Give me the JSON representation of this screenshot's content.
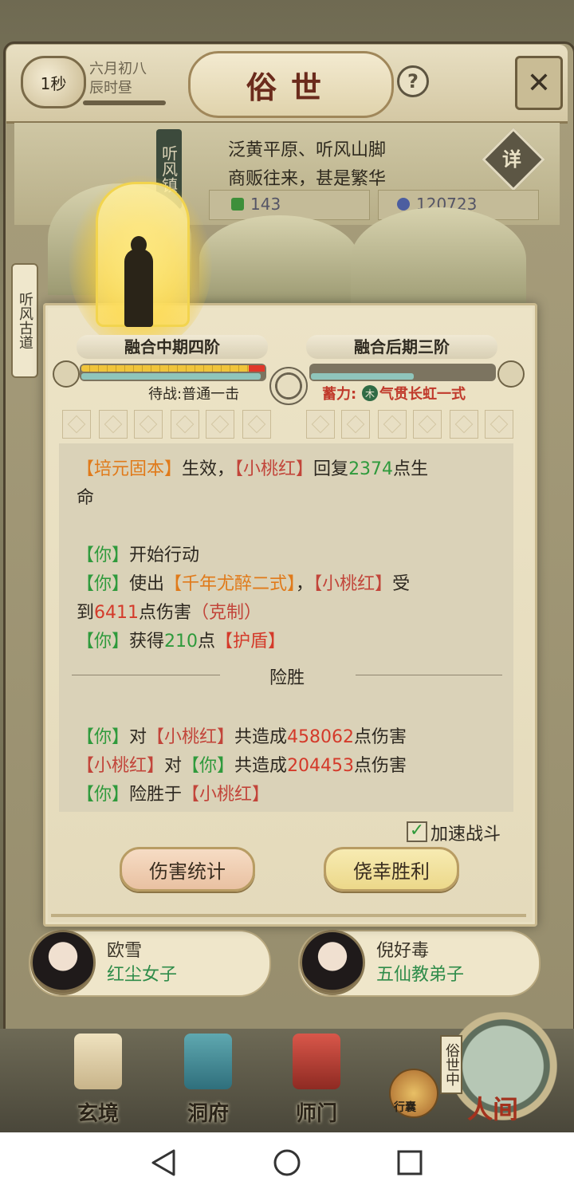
{
  "header": {
    "time_badge": "1秒",
    "date_line1": "六月初八",
    "date_line2": "辰时昼",
    "title": "俗世",
    "help_label": "?"
  },
  "location": {
    "sign": "听风镇",
    "line1": "泛黄平原、听风山脚",
    "line2": "商贩往来，甚是繁华",
    "detail_label": "详",
    "resource1": "143",
    "resource2": "120723"
  },
  "side_label": "听风古道",
  "battle": {
    "left_realm": "融合中期四阶",
    "right_realm": "融合后期三阶",
    "left_hp_fraction": 0.98,
    "left_mp_fraction": 0.98,
    "right_hp_fraction": 0.0,
    "right_mp_fraction": 0.56,
    "left_stance": "待战:普通一击",
    "right_stance_label": "蓄力:",
    "right_stance_element": "木",
    "right_stance_skill": "气贯长虹一式",
    "log": {
      "l1_a": "【培元固本】",
      "l1_b": "生效，",
      "l1_c": "【小桃红】",
      "l1_d": "回复",
      "l1_e": "2374",
      "l1_f": "点生",
      "l2_a": "命",
      "l3_a": "【你】",
      "l3_b": "开始行动",
      "l4_a": "【你】",
      "l4_b": "使出",
      "l4_c": "【千年尤醉二式】",
      "l4_d": "，",
      "l4_e": "【小桃红】",
      "l4_f": "受",
      "l5_a": "到",
      "l5_b": "6411",
      "l5_c": "点伤害",
      "l5_d": "（克制）",
      "l6_a": "【你】",
      "l6_b": "获得",
      "l6_c": "210",
      "l6_d": "点",
      "l6_e": "【护盾】",
      "result_title": "险胜",
      "s1_a": "【你】",
      "s1_b": "对",
      "s1_c": "【小桃红】",
      "s1_d": "共造成",
      "s1_e": "458062",
      "s1_f": "点伤害",
      "s2_a": "【小桃红】",
      "s2_b": "对",
      "s2_c": "【你】",
      "s2_d": "共造成",
      "s2_e": "204453",
      "s2_f": "点伤害",
      "s3_a": "【你】",
      "s3_b": "险胜于",
      "s3_c": "【小桃红】"
    },
    "speed_up_label": "加速战斗",
    "speed_up_checked": true,
    "damage_stats_button": "伤害统计",
    "lucky_win_button": "侥幸胜利"
  },
  "characters": [
    {
      "name": "欧雪",
      "role": "红尘女子"
    },
    {
      "name": "倪好毒",
      "role": "五仙教弟子"
    }
  ],
  "nav": {
    "xuanjing": "玄境",
    "dongfu": "洞府",
    "shimen": "师门",
    "xingnang": "行囊",
    "renjian": "人间",
    "suzhong": "俗世中"
  },
  "colors": {
    "ally_name": "#2f9a3c",
    "enemy_name": "#c2453a",
    "skill_name": "#e07a1a",
    "damage_number": "#d43a2a"
  }
}
